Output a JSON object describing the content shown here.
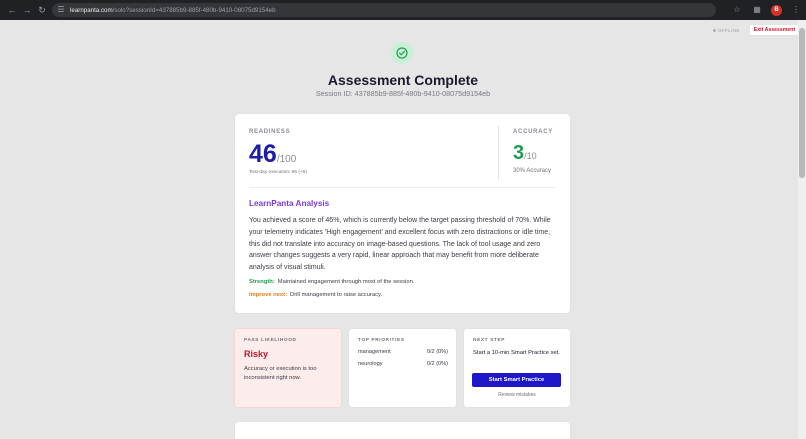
{
  "browser": {
    "url_host": "learnpanta.com",
    "url_path": "/solo?sessionId=437885b9-885f-480b-9410-08075d9154eb",
    "profile_initial": "B"
  },
  "topbar": {
    "offline_label": "OFFLINE",
    "exit_label": "Exit Assessment"
  },
  "header": {
    "title": "Assessment Complete",
    "session_line": "Session ID: 437885b9-885f-480b-9410-08075d9154eb"
  },
  "readiness": {
    "label": "READINESS",
    "score": "46",
    "denominator": "/100",
    "test_day": "Test-day execution: 95 (+5)"
  },
  "accuracy": {
    "label": "ACCURACY",
    "score": "3",
    "denominator": "/10",
    "percent": "30% Accuracy"
  },
  "analysis": {
    "title": "LearnPanta Analysis",
    "body": "You achieved a score of 46%, which is currently below the target passing threshold of 70%. While your telemetry indicates 'High engagement' and excellent focus with zero distractions or idle time, this did not translate into accuracy on image-based questions. The lack of tool usage and zero answer changes suggests a very rapid, linear approach that may benefit from more deliberate analysis of visual stimuli.",
    "strength_tag": "Strength:",
    "strength_text": "Maintained engagement through most of the session.",
    "improve_tag": "Improve next:",
    "improve_text": "Drill management to raise accuracy."
  },
  "pass_likelihood": {
    "label": "PASS LIKELIHOOD",
    "value": "Risky",
    "note": "Accuracy or execution is too inconsistent right now."
  },
  "top_priorities": {
    "label": "TOP PRIORITIES",
    "items": [
      {
        "name": "management",
        "score": "0/2 (0%)"
      },
      {
        "name": "neurology",
        "score": "0/2 (0%)"
      }
    ]
  },
  "next_step": {
    "label": "NEXT STEP",
    "text": "Start a 10-min Smart Practice set.",
    "button": "Start Smart Practice",
    "link": "Review mistakes"
  },
  "colors": {
    "readiness_accent": "#1a1ea8",
    "accuracy_accent": "#1f9e50",
    "analysis_accent": "#7c3aed",
    "risk_accent": "#c0182a",
    "button_primary": "#1f16c8"
  }
}
